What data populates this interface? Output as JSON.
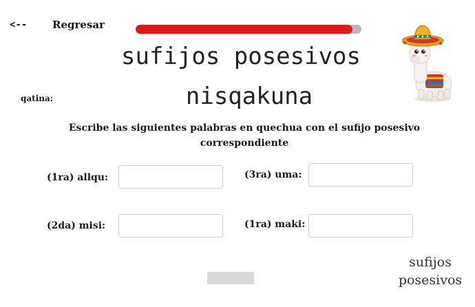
{
  "nav": {
    "back_arrow": "<--",
    "back_label": "Regresar"
  },
  "progress": {
    "value": 0.96
  },
  "title": {
    "line1": "sufijos posesivos",
    "line2": "nisqakuna"
  },
  "qatina_label": "qatina:",
  "instructions": "Escribe las siguientes palabras en quechua con el sufijo posesivo correspondiente",
  "exercises": [
    {
      "label": "(1ra) allqu:",
      "value": ""
    },
    {
      "label": "(3ra) uma:",
      "value": ""
    },
    {
      "label": "(2da) misi:",
      "value": ""
    },
    {
      "label": "(1ra) maki:",
      "value": ""
    }
  ],
  "check_button": {
    "label": ""
  },
  "corner_label": {
    "line1": "sufijos",
    "line2": "posesivos"
  },
  "colors": {
    "progress_fill": "#dc1a1a",
    "progress_track": "#b9b9b9"
  }
}
